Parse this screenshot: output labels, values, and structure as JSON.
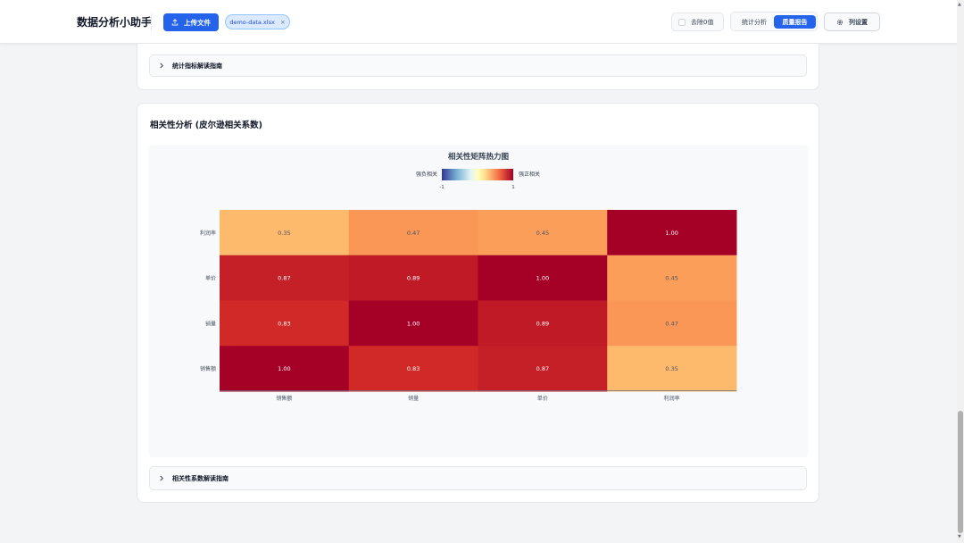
{
  "header": {
    "app_title": "数据分析小助手",
    "upload_label": "上传文件",
    "file_chip_label": "demo-data.xlsx",
    "file_chip_close": "×",
    "remove_zero_label": "去除0值",
    "tabs": [
      {
        "label": "统计分析",
        "active": false
      },
      {
        "label": "质量报告",
        "active": true
      }
    ],
    "column_settings_label": "列设置"
  },
  "stats_guide": {
    "label": "统计指标解读指南"
  },
  "correlation": {
    "title": "相关性分析 (皮尔逊相关系数)",
    "guide_label": "相关性系数解读指南"
  },
  "icons": {
    "upload": "upload-icon",
    "chevron": "chevron-right-icon",
    "settings": "gear-icon"
  },
  "colors": {
    "accent": "#2563eb",
    "strong_negative": "#313695",
    "neutral": "#ffffbf",
    "strong_positive": "#a50026"
  },
  "chart_data": {
    "type": "heatmap",
    "title": "相关性矩阵热力图",
    "x_categories": [
      "销售额",
      "销量",
      "单价",
      "利润率"
    ],
    "y_categories": [
      "销售额",
      "销量",
      "单价",
      "利润率"
    ],
    "values": [
      [
        1.0,
        0.83,
        0.87,
        0.35
      ],
      [
        0.83,
        1.0,
        0.89,
        0.47
      ],
      [
        0.87,
        0.89,
        1.0,
        0.45
      ],
      [
        0.35,
        0.47,
        0.45,
        1.0
      ]
    ],
    "color_range": [
      -1,
      1
    ],
    "legend": {
      "min_label": "强负相关",
      "max_label": "强正相关",
      "min_value": "-1",
      "max_value": "1",
      "position": "top-center"
    }
  }
}
